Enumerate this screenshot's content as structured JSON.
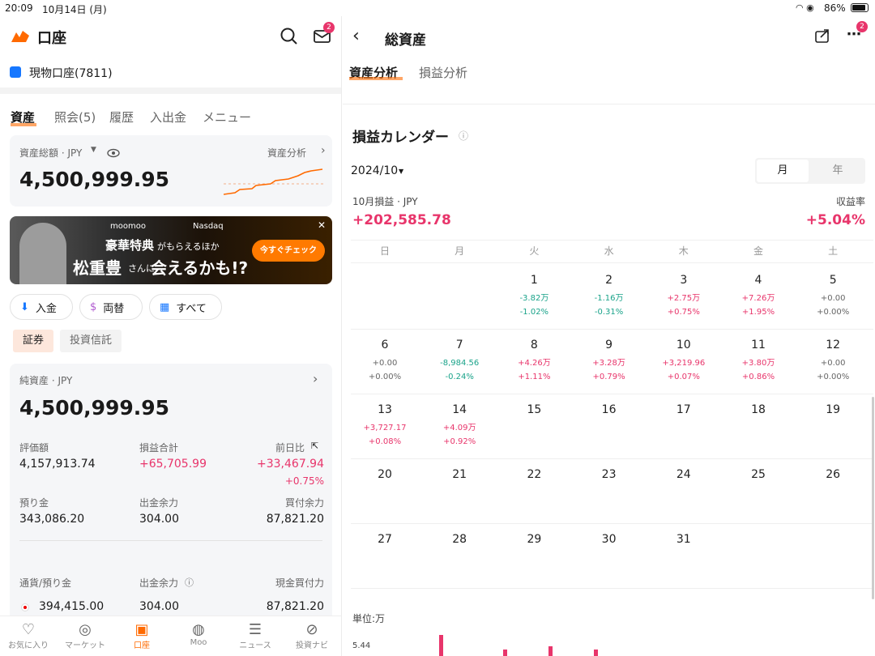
{
  "status": {
    "time": "20:09",
    "date": "10月14日 (月)",
    "battery": "86%",
    "mail_badge": "2"
  },
  "left": {
    "title": "口座",
    "account": "現物口座(7811)",
    "tabs": [
      "資産",
      "照会(5)",
      "履歴",
      "入出金",
      "メニュー"
    ],
    "assets": {
      "label": "資産総額 · JPY",
      "value": "4,500,999.95",
      "link": "資産分析"
    },
    "banner": {
      "brand": "moomoo",
      "brand2": "Nasdaq",
      "headline1": "豪華特典",
      "headline1b": "がもらえるほか",
      "headline2": "松重豊",
      "headline2b": "さんに",
      "headline2c": "会えるかも!?",
      "cta": "今すぐチェック"
    },
    "actions": [
      "入金",
      "両替",
      "すべて"
    ],
    "subtabs": [
      "証券",
      "投資信託"
    ],
    "net": {
      "label": "純資産 · JPY",
      "value": "4,500,999.95",
      "r1": [
        {
          "label": "評価額",
          "value": "4,157,913.74"
        },
        {
          "label": "損益合計",
          "value": "+65,705.99"
        },
        {
          "label": "前日比",
          "value": "+33,467.94",
          "sub": "+0.75%"
        }
      ],
      "r2": [
        {
          "label": "預り金",
          "value": "343,086.20"
        },
        {
          "label": "出金余力",
          "value": "304.00"
        },
        {
          "label": "買付余力",
          "value": "87,821.20"
        }
      ],
      "currency_header": [
        "通貨/預り金",
        "出金余力",
        "現金買付力"
      ],
      "jpy_row": [
        "394,415.00",
        "304.00",
        "87,821.20"
      ]
    },
    "nav": [
      "お気に入り",
      "マーケット",
      "口座",
      "Moo",
      "ニュース",
      "投資ナビ"
    ]
  },
  "right": {
    "title": "総資産",
    "badge": "2",
    "tabs": [
      "資産分析",
      "損益分析"
    ],
    "calendar_title": "損益カレンダー",
    "month": "2024/10",
    "toggle": [
      "月",
      "年"
    ],
    "pnl_label": "10月損益 · JPY",
    "pnl_value": "+202,585.78",
    "rate_label": "収益率",
    "rate_value": "+5.04%",
    "weekdays": [
      "日",
      "月",
      "火",
      "水",
      "木",
      "金",
      "土"
    ],
    "days": [
      {
        "d": "1",
        "v": "-3.82万",
        "p": "-1.02%",
        "s": "neg"
      },
      {
        "d": "2",
        "v": "-1.16万",
        "p": "-0.31%",
        "s": "neg"
      },
      {
        "d": "3",
        "v": "+2.75万",
        "p": "+0.75%",
        "s": "pos"
      },
      {
        "d": "4",
        "v": "+7.26万",
        "p": "+1.95%",
        "s": "pos"
      },
      {
        "d": "5",
        "v": "+0.00",
        "p": "+0.00%",
        "s": "zero"
      },
      {
        "d": "6",
        "v": "+0.00",
        "p": "+0.00%",
        "s": "zero"
      },
      {
        "d": "7",
        "v": "-8,984.56",
        "p": "-0.24%",
        "s": "neg"
      },
      {
        "d": "8",
        "v": "+4.26万",
        "p": "+1.11%",
        "s": "pos"
      },
      {
        "d": "9",
        "v": "+3.28万",
        "p": "+0.79%",
        "s": "pos"
      },
      {
        "d": "10",
        "v": "+3,219.96",
        "p": "+0.07%",
        "s": "pos"
      },
      {
        "d": "11",
        "v": "+3.80万",
        "p": "+0.86%",
        "s": "pos"
      },
      {
        "d": "12",
        "v": "+0.00",
        "p": "+0.00%",
        "s": "zero"
      },
      {
        "d": "13",
        "v": "+3,727.17",
        "p": "+0.08%",
        "s": "pos"
      },
      {
        "d": "14",
        "v": "+4.09万",
        "p": "+0.92%",
        "s": "pos"
      },
      {
        "d": "15"
      },
      {
        "d": "16"
      },
      {
        "d": "17"
      },
      {
        "d": "18"
      },
      {
        "d": "19"
      },
      {
        "d": "20"
      },
      {
        "d": "21"
      },
      {
        "d": "22"
      },
      {
        "d": "23"
      },
      {
        "d": "24"
      },
      {
        "d": "25"
      },
      {
        "d": "26"
      },
      {
        "d": "27"
      },
      {
        "d": "28"
      },
      {
        "d": "29"
      },
      {
        "d": "30"
      },
      {
        "d": "31"
      }
    ],
    "unit": "単位:万",
    "y_tick": "5.44"
  },
  "colors": {
    "accent": "#ff6a00",
    "positive": "#e8356b",
    "negative": "#1aa38a"
  }
}
